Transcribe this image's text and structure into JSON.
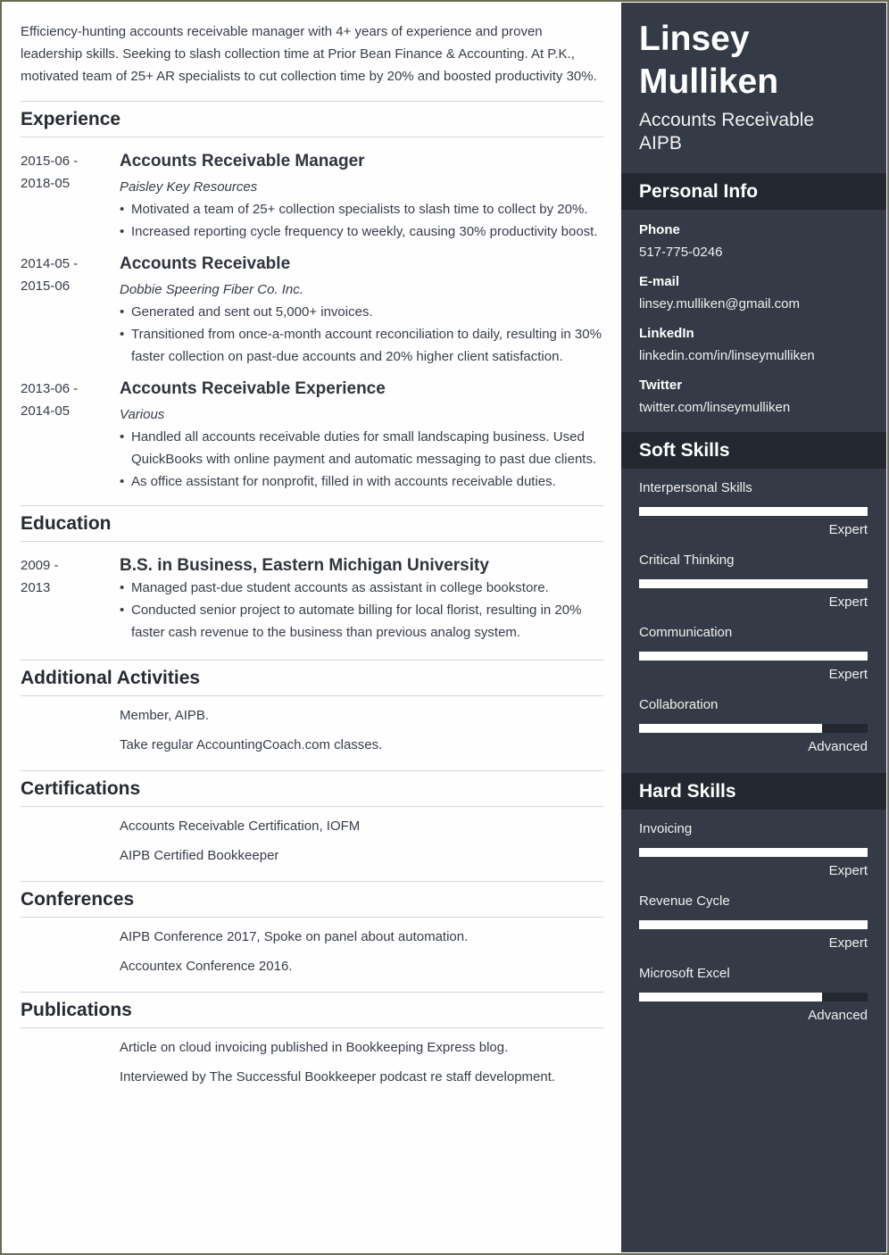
{
  "header": {
    "name_line1": "Linsey",
    "name_line2": "Mulliken",
    "title_line1": "Accounts Receivable",
    "title_line2": "AIPB"
  },
  "summary": "Efficiency-hunting accounts receivable manager with 4+ years of experience and proven leadership skills. Seeking to slash collection time at Prior Bean Finance & Accounting. At P.K., motivated team of 25+ AR specialists to cut collection time by 20% and boosted productivity 30%.",
  "experience": {
    "heading": "Experience",
    "entries": [
      {
        "date_start": "2015-06 -",
        "date_end": "2018-05",
        "title": "Accounts Receivable Manager",
        "company": "Paisley Key Resources",
        "bullets": [
          "Motivated a team of 25+ collection specialists to slash time to collect by 20%.",
          "Increased reporting cycle frequency to weekly, causing 30% productivity boost."
        ]
      },
      {
        "date_start": "2014-05 -",
        "date_end": "2015-06",
        "title": "Accounts Receivable",
        "company": "Dobbie Speering Fiber Co. Inc.",
        "bullets": [
          "Generated and sent out 5,000+ invoices.",
          "Transitioned from once-a-month account reconciliation to daily, resulting in 30% faster collection on past-due accounts and 20% higher client satisfaction."
        ]
      },
      {
        "date_start": "2013-06 -",
        "date_end": "2014-05",
        "title": "Accounts Receivable Experience",
        "company": "Various",
        "bullets": [
          "Handled all accounts receivable duties for small landscaping business. Used QuickBooks with online payment and automatic messaging to past due clients.",
          "As office assistant for nonprofit, filled in with accounts receivable duties."
        ]
      }
    ]
  },
  "education": {
    "heading": "Education",
    "entries": [
      {
        "date_start": "2009 -",
        "date_end": "2013",
        "title": "B.S. in Business, Eastern Michigan University",
        "bullets": [
          "Managed past-due student accounts as assistant in college bookstore.",
          "Conducted senior project to automate billing for local florist, resulting in 20% faster cash revenue to the business than previous analog system."
        ]
      }
    ]
  },
  "activities": {
    "heading": "Additional Activities",
    "items": [
      "Member, AIPB.",
      "Take regular AccountingCoach.com classes."
    ]
  },
  "certifications": {
    "heading": "Certifications",
    "items": [
      "Accounts Receivable Certification, IOFM",
      "AIPB Certified Bookkeeper"
    ]
  },
  "conferences": {
    "heading": "Conferences",
    "items": [
      "AIPB Conference 2017, Spoke on panel about automation.",
      "Accountex Conference 2016."
    ]
  },
  "publications": {
    "heading": "Publications",
    "items": [
      "Article on cloud invoicing published in Bookkeeping Express blog.",
      "Interviewed by The Successful Bookkeeper podcast re staff development."
    ]
  },
  "personal_info": {
    "heading": "Personal Info",
    "items": [
      {
        "label": "Phone",
        "value": "517-775-0246"
      },
      {
        "label": "E-mail",
        "value": "linsey.mulliken@gmail.com"
      },
      {
        "label": "LinkedIn",
        "value": "linkedin.com/in/linseymulliken"
      },
      {
        "label": "Twitter",
        "value": "twitter.com/linseymulliken"
      }
    ]
  },
  "soft_skills": {
    "heading": "Soft Skills",
    "items": [
      {
        "name": "Interpersonal Skills",
        "level": "Expert",
        "fraction": 1.0
      },
      {
        "name": "Critical Thinking",
        "level": "Expert",
        "fraction": 1.0
      },
      {
        "name": "Communication",
        "level": "Expert",
        "fraction": 1.0
      },
      {
        "name": "Collaboration",
        "level": "Advanced",
        "fraction": 0.8
      }
    ]
  },
  "hard_skills": {
    "heading": "Hard Skills",
    "items": [
      {
        "name": "Invoicing",
        "level": "Expert",
        "fraction": 1.0
      },
      {
        "name": "Revenue Cycle",
        "level": "Expert",
        "fraction": 1.0
      },
      {
        "name": "Microsoft Excel",
        "level": "Advanced",
        "fraction": 0.8
      }
    ]
  },
  "colors": {
    "sidebar_bg": "#343a46",
    "sidebar_header_bg": "#23272f",
    "text_dark": "#373d48",
    "bar_fill": "#ffffff"
  }
}
